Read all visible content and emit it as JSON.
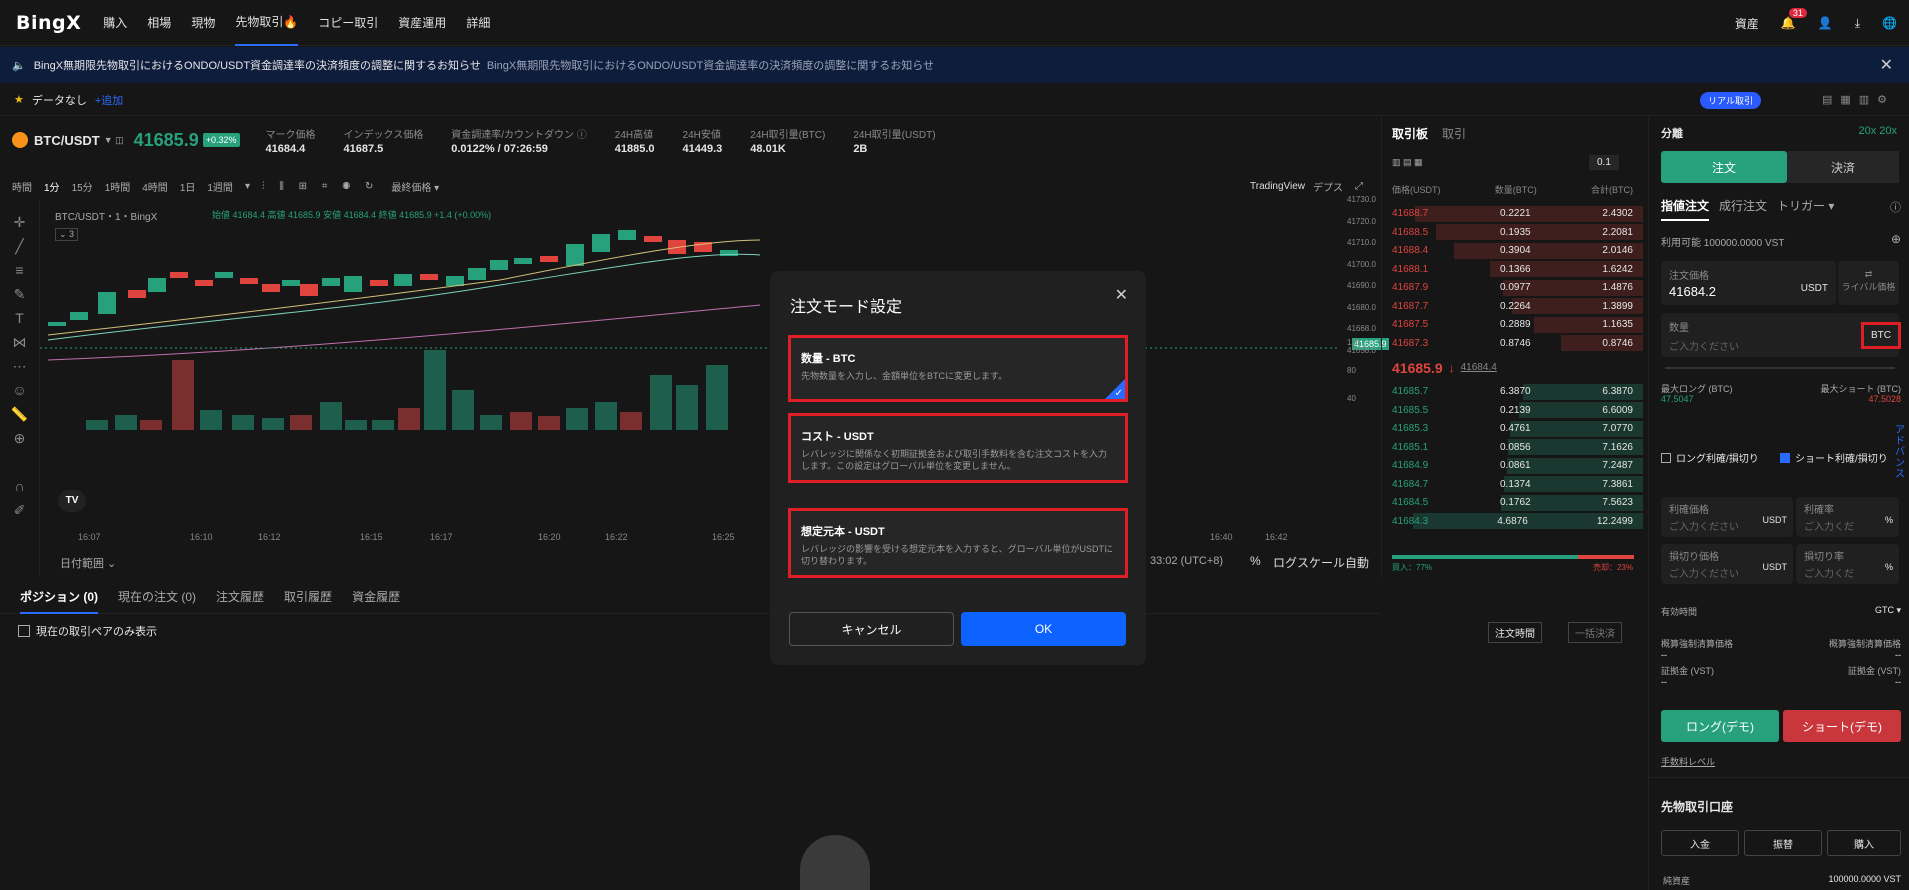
{
  "nav": {
    "logo": "BingX",
    "items": [
      "購入",
      "相場",
      "現物",
      "先物取引🔥",
      "コピー取引",
      "資産運用",
      "詳細"
    ],
    "assets": "資産",
    "notif_count": "31"
  },
  "banner": {
    "text1": "BingX無期限先物取引におけるONDO/USDT資金調達率の決済頻度の調整に関するお知らせ",
    "text2": "BingX無期限先物取引におけるONDO/USDT資金調達率の決済頻度の調整に関するお知らせ"
  },
  "fav": {
    "nodata": "データなし",
    "add": "+追加",
    "live": "リアル取引"
  },
  "ticker": {
    "pair": "BTC/USDT",
    "price": "41685.9",
    "change": "+0.32%",
    "stats": [
      {
        "l": "マーク価格",
        "v": "41684.4"
      },
      {
        "l": "インデックス価格",
        "v": "41687.5"
      },
      {
        "l": "資金調達率/カウントダウン ⓘ",
        "v": "0.0122% / 07:26:59"
      },
      {
        "l": "24H高値",
        "v": "41885.0"
      },
      {
        "l": "24H安値",
        "v": "41449.3"
      },
      {
        "l": "24H取引量(BTC)",
        "v": "48.01K"
      },
      {
        "l": "24H取引量(USDT)",
        "v": "2B"
      }
    ]
  },
  "chartbar": {
    "items": [
      "時間",
      "1分",
      "15分",
      "1時間",
      "4時間",
      "1日",
      "1週間",
      "▾",
      "最終価格 ▾"
    ],
    "tv": "TradingView",
    "depth": "デプス"
  },
  "chartinfo": {
    "title": "BTC/USDT・1・BingX",
    "ohlc": "始値 41684.4  高値 41685.9  安値 41684.4  終値 41685.9  +1.4 (+0.00%)",
    "price_tag": "41685.9",
    "daterange": "日付範囲 ⌄",
    "timeinfo": "33:02 (UTC+8)",
    "pct": "%",
    "log": "ログスケール",
    "auto": "自動"
  },
  "chart_axis": {
    "y": [
      "41730.0",
      "41720.0",
      "41710.0",
      "41700.0",
      "41690.0",
      "41680.0",
      "41668.0",
      "41658.0"
    ],
    "vol": [
      "120",
      "80",
      "40"
    ],
    "x": [
      "16:07",
      "16:10",
      "16:12",
      "16:15",
      "16:17",
      "16:20",
      "16:22",
      "16:25",
      "16:40",
      "16:42"
    ]
  },
  "bottomtabs": {
    "items": [
      "ポジション (0)",
      "現在の注文 (0)",
      "注文履歴",
      "取引履歴",
      "資金履歴"
    ],
    "checkbox": "現在の取引ペアのみ表示",
    "sort": "注文時間",
    "closeall": "一括決済"
  },
  "orderbook": {
    "tabs": [
      "取引板",
      "取引"
    ],
    "precision": "0.1",
    "headers": [
      "価格(USDT)",
      "数量(BTC)",
      "合計(BTC)"
    ],
    "asks": [
      [
        "41688.7",
        "0.2221",
        "2.4302"
      ],
      [
        "41688.5",
        "0.1935",
        "2.2081"
      ],
      [
        "41688.4",
        "0.3904",
        "2.0146"
      ],
      [
        "41688.1",
        "0.1366",
        "1.6242"
      ],
      [
        "41687.9",
        "0.0977",
        "1.4876"
      ],
      [
        "41687.7",
        "0.2264",
        "1.3899"
      ],
      [
        "41687.5",
        "0.2889",
        "1.1635"
      ],
      [
        "41687.3",
        "0.8746",
        "0.8746"
      ]
    ],
    "last": "41685.9",
    "mark": "41684.4",
    "bids": [
      [
        "41685.7",
        "6.3870",
        "6.3870"
      ],
      [
        "41685.5",
        "0.2139",
        "6.6009"
      ],
      [
        "41685.3",
        "0.4761",
        "7.0770"
      ],
      [
        "41685.1",
        "0.0856",
        "7.1626"
      ],
      [
        "41684.9",
        "0.0861",
        "7.2487"
      ],
      [
        "41684.7",
        "0.1374",
        "7.3861"
      ],
      [
        "41684.5",
        "0.1762",
        "7.5623"
      ],
      [
        "41684.3",
        "4.6876",
        "12.2499"
      ]
    ],
    "buy": "買入：77%",
    "sell": "売却：23%"
  },
  "rightpanel": {
    "mode": "分離",
    "leverage": "20x 20x",
    "tab_open": "注文",
    "tab_close": "決済",
    "order_types": [
      "指値注文",
      "成行注文",
      "トリガー ▾"
    ],
    "available": "利用可能 100000.0000 VST",
    "price_label": "注文価格",
    "price_value": "41684.2",
    "unit_usdt": "USDT",
    "rival": "ライバル価格",
    "qty_label": "数量",
    "qty_placeholder": "ご入力ください",
    "qty_unit": "BTC",
    "max_long_l": "最大ロング (BTC)",
    "max_long_v": "47.5047",
    "max_short_l": "最大ショート (BTC)",
    "max_short_v": "47.5028",
    "tp_check": "ロング利確/損切り",
    "sl_check": "ショート利確/損切り",
    "advanced": "アドバンス",
    "tp_price": "利確価格",
    "tp_rate": "利確率",
    "sl_price": "損切り価格",
    "sl_rate": "損切り率",
    "input_ph": "ご入力ください",
    "input_ph2": "ご入力くだ",
    "pct": "%",
    "validity": "有効時間",
    "gtc": "GTC ▾",
    "liq1": "概算強制清算価格",
    "liq2": "概算強制清算価格",
    "dash": "--",
    "margin1": "証拠金 (VST)",
    "margin2": "証拠金 (VST)",
    "long_btn": "ロング(デモ)",
    "short_btn": "ショート(デモ)",
    "fee": "手数料レベル",
    "account": "先物取引口座",
    "deposit": "入金",
    "transfer": "振替",
    "buy": "購入",
    "equity": "純資産",
    "equity_v": "100000.0000 VST"
  },
  "modal": {
    "title": "注文モード設定",
    "opts": [
      {
        "t": "数量 - BTC",
        "d": "先物数量を入力し、金額単位をBTCに変更します。"
      },
      {
        "t": "コスト - USDT",
        "d": "レバレッジに関係なく初期証拠金および取引手数料を含む注文コストを入力します。この設定はグローバル単位を変更しません。"
      },
      {
        "t": "想定元本 - USDT",
        "d": "レバレッジの影響を受ける想定元本を入力すると、グローバル単位がUSDTに切り替わります。"
      }
    ],
    "cancel": "キャンセル",
    "ok": "OK"
  },
  "colors": {
    "accent": "#2a6bff",
    "up": "#26a17b",
    "down": "#e0443e",
    "modal_border": "#e01e26"
  }
}
